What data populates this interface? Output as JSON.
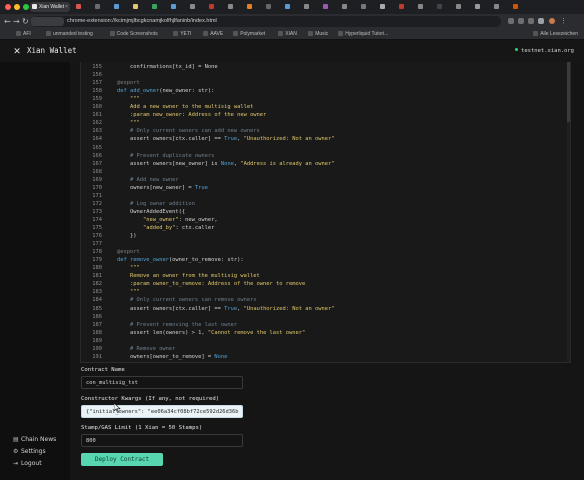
{
  "browser": {
    "tab_title": "Xian Wallet",
    "tab_close": "×",
    "url": "chrome-extension://kcimjmjlbcgkcnamjkolfhjlfaninb/index.html",
    "right_bookmark": "Alle Lesezeichen",
    "bookmarks": [
      "AFI",
      "unmanded testing",
      "Code Screenshots",
      "YETI",
      "AAVE",
      "Polymarket",
      "XIAN",
      "Music",
      "Hyperliquid Tutori..."
    ]
  },
  "header": {
    "app_title": "Xian Wallet",
    "network": "testnet.xian.org"
  },
  "sidebar": {
    "items": [
      {
        "label": "Chain News",
        "icon": "news-icon"
      },
      {
        "label": "Settings",
        "icon": "gear-icon"
      },
      {
        "label": "Logout",
        "icon": "logout-icon"
      }
    ]
  },
  "code": {
    "lines": [
      {
        "n": "155",
        "text": "    confirmations[tx_id] = None",
        "tokens": [
          [
            "    confirmations[tx_id] = None",
            "default"
          ]
        ]
      },
      {
        "n": "156",
        "text": "",
        "tokens": []
      },
      {
        "n": "157",
        "text": "@export",
        "tokens": [
          [
            "@export",
            "decorator"
          ]
        ]
      },
      {
        "n": "158",
        "text": "def add_owner(new_owner: str):",
        "tokens": [
          [
            "def ",
            "keyword"
          ],
          [
            "add_owner",
            "funcname"
          ],
          [
            "(new_owner: str):",
            "default"
          ]
        ]
      },
      {
        "n": "159",
        "text": "    \"\"\"",
        "tokens": [
          [
            "    \"\"\"",
            "string"
          ]
        ]
      },
      {
        "n": "160",
        "text": "    Add a new owner to the multisig wallet",
        "tokens": [
          [
            "    Add a new owner to the multisig wallet",
            "string"
          ]
        ]
      },
      {
        "n": "161",
        "text": "    :param new_owner: Address of the new owner",
        "tokens": [
          [
            "    :param new_owner: Address of the new owner",
            "string"
          ]
        ]
      },
      {
        "n": "162",
        "text": "    \"\"\"",
        "tokens": [
          [
            "    \"\"\"",
            "string"
          ]
        ]
      },
      {
        "n": "163",
        "text": "    # Only current owners can add new owners",
        "tokens": [
          [
            "    # Only current owners can add new owners",
            "comment"
          ]
        ]
      },
      {
        "n": "164",
        "text": "    assert owners[ctx.caller] == True, \"Unauthorized: Not an owner\"",
        "tokens": [
          [
            "    assert owners[ctx.caller] == ",
            "default"
          ],
          [
            "True",
            "constant"
          ],
          [
            ", ",
            "default"
          ],
          [
            "\"Unauthorized: Not an owner\"",
            "string"
          ]
        ]
      },
      {
        "n": "165",
        "text": "",
        "tokens": []
      },
      {
        "n": "166",
        "text": "    # Prevent duplicate owners",
        "tokens": [
          [
            "    # Prevent duplicate owners",
            "comment"
          ]
        ]
      },
      {
        "n": "167",
        "text": "    assert owners[new_owner] is None, \"Address is already an owner\"",
        "tokens": [
          [
            "    assert owners[new_owner] is ",
            "default"
          ],
          [
            "None",
            "constant"
          ],
          [
            ", ",
            "default"
          ],
          [
            "\"Address is already an owner\"",
            "string"
          ]
        ]
      },
      {
        "n": "168",
        "text": "",
        "tokens": []
      },
      {
        "n": "169",
        "text": "    # Add new owner",
        "tokens": [
          [
            "    # Add new owner",
            "comment"
          ]
        ]
      },
      {
        "n": "170",
        "text": "    owners[new_owner] = True",
        "tokens": [
          [
            "    owners[new_owner] = ",
            "default"
          ],
          [
            "True",
            "constant"
          ]
        ]
      },
      {
        "n": "171",
        "text": "",
        "tokens": []
      },
      {
        "n": "172",
        "text": "    # Log owner addition",
        "tokens": [
          [
            "    # Log owner addition",
            "comment"
          ]
        ]
      },
      {
        "n": "173",
        "text": "    OwnerAddedEvent({",
        "tokens": [
          [
            "    OwnerAddedEvent({",
            "default"
          ]
        ]
      },
      {
        "n": "174",
        "text": "        \"new_owner\": new_owner,",
        "tokens": [
          [
            "        ",
            "default"
          ],
          [
            "\"new_owner\"",
            "string"
          ],
          [
            ": new_owner,",
            "default"
          ]
        ]
      },
      {
        "n": "175",
        "text": "        \"added_by\": ctx.caller",
        "tokens": [
          [
            "        ",
            "default"
          ],
          [
            "\"added_by\"",
            "string"
          ],
          [
            ": ctx.caller",
            "default"
          ]
        ]
      },
      {
        "n": "176",
        "text": "    })",
        "tokens": [
          [
            "    })",
            "default"
          ]
        ]
      },
      {
        "n": "177",
        "text": "",
        "tokens": []
      },
      {
        "n": "178",
        "text": "@export",
        "tokens": [
          [
            "@export",
            "decorator"
          ]
        ]
      },
      {
        "n": "179",
        "text": "def remove_owner(owner_to_remove: str):",
        "tokens": [
          [
            "def ",
            "keyword"
          ],
          [
            "remove_owner",
            "funcname"
          ],
          [
            "(owner_to_remove: str):",
            "default"
          ]
        ]
      },
      {
        "n": "180",
        "text": "    \"\"\"",
        "tokens": [
          [
            "    \"\"\"",
            "string"
          ]
        ]
      },
      {
        "n": "181",
        "text": "    Remove an owner from the multisig wallet",
        "tokens": [
          [
            "    Remove an owner from the multisig wallet",
            "string"
          ]
        ]
      },
      {
        "n": "182",
        "text": "    :param owner_to_remove: Address of the owner to remove",
        "tokens": [
          [
            "    :param owner_to_remove: Address of the owner to remove",
            "string"
          ]
        ]
      },
      {
        "n": "183",
        "text": "    \"\"\"",
        "tokens": [
          [
            "    \"\"\"",
            "string"
          ]
        ]
      },
      {
        "n": "184",
        "text": "    # Only current owners can remove owners",
        "tokens": [
          [
            "    # Only current owners can remove owners",
            "comment"
          ]
        ]
      },
      {
        "n": "185",
        "text": "    assert owners[ctx.caller] == True, \"Unauthorized: Not an owner\"",
        "tokens": [
          [
            "    assert owners[ctx.caller] == ",
            "default"
          ],
          [
            "True",
            "constant"
          ],
          [
            ", ",
            "default"
          ],
          [
            "\"Unauthorized: Not an owner\"",
            "string"
          ]
        ]
      },
      {
        "n": "186",
        "text": "",
        "tokens": []
      },
      {
        "n": "187",
        "text": "    # Prevent removing the last owner",
        "tokens": [
          [
            "    # Prevent removing the last owner",
            "comment"
          ]
        ]
      },
      {
        "n": "188",
        "text": "    assert len(owners) > 1, \"Cannot remove the last owner\"",
        "tokens": [
          [
            "    assert len(owners) > ",
            "default"
          ],
          [
            "1",
            "number"
          ],
          [
            ", ",
            "default"
          ],
          [
            "\"Cannot remove the last owner\"",
            "string"
          ]
        ]
      },
      {
        "n": "189",
        "text": "",
        "tokens": []
      },
      {
        "n": "190",
        "text": "    # Remove owner",
        "tokens": [
          [
            "    # Remove owner",
            "comment"
          ]
        ]
      },
      {
        "n": "191",
        "text": "    owners[owner_to_remove] = None",
        "tokens": [
          [
            "    owners[owner_to_remove] = ",
            "default"
          ],
          [
            "None",
            "constant"
          ]
        ]
      }
    ]
  },
  "form": {
    "contract_name_label": "Contract Name",
    "contract_name_value": "con_multisig_tst",
    "kwargs_label": "Constructor Kwargs (If any, not required)",
    "kwargs_value": "{\"initial_owners\": \"ee06a34cf08bf72ce592d26d36b",
    "stamp_label": "Stamp/GAS Limit (1 Xian = 50 Stamps)",
    "stamp_value": "800",
    "deploy_label": "Deploy Contract"
  },
  "colors": {
    "default": "#d4d4d4",
    "keyword": "#4fa3d9",
    "funcname": "#4fa3d9",
    "decorator": "#7f7f7f",
    "string": "#e3c86a",
    "comment": "#6f7f8f",
    "constant": "#4fa3d9",
    "number": "#b5cea8",
    "accent": "#57d6b0",
    "network_dot": "#2fd07a"
  }
}
